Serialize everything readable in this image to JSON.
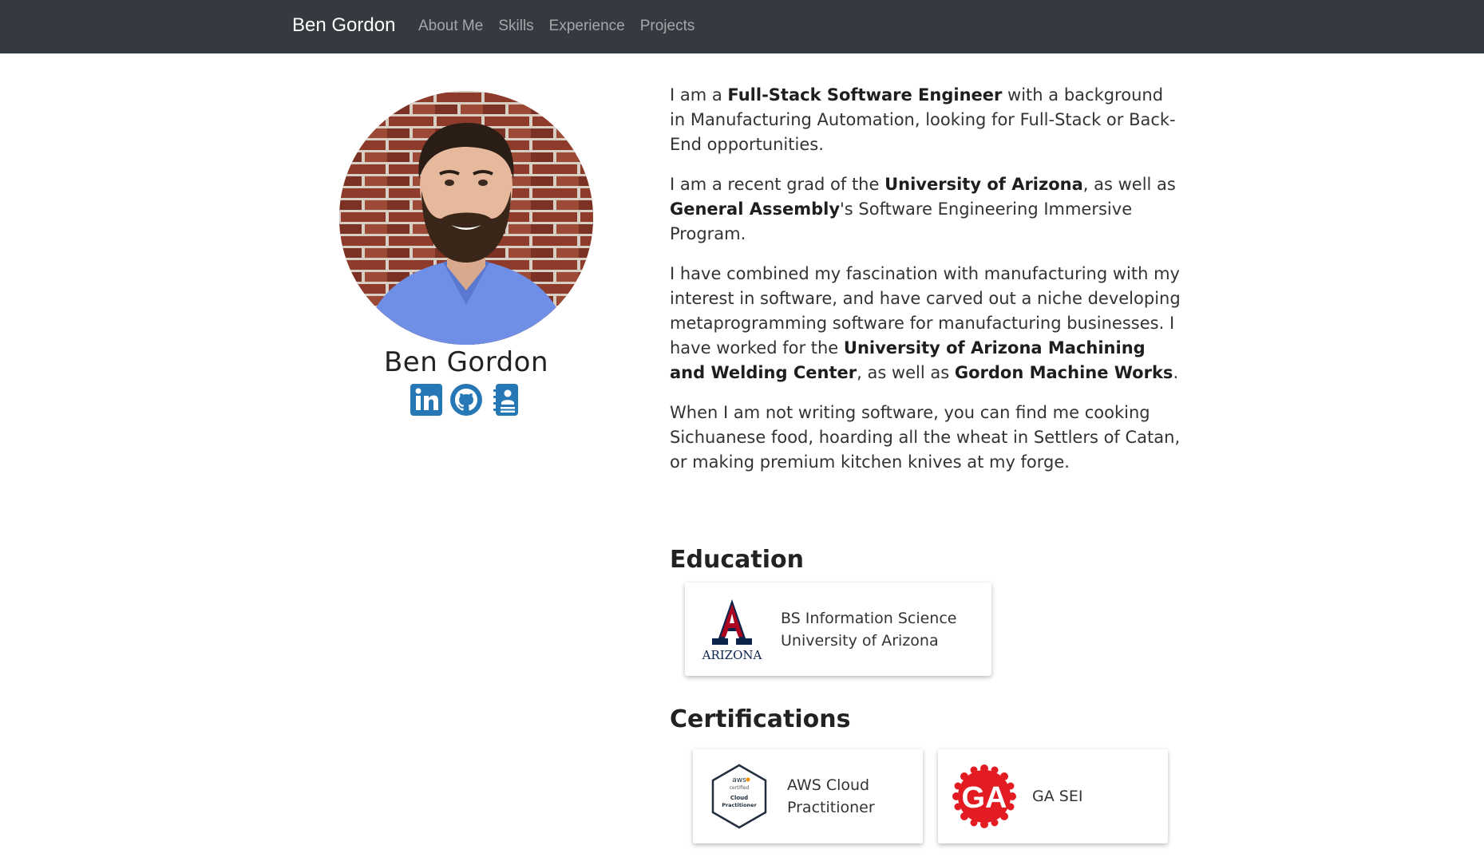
{
  "navbar": {
    "brand": "Ben Gordon",
    "links": [
      "About Me",
      "Skills",
      "Experience",
      "Projects"
    ]
  },
  "profile": {
    "name": "Ben Gordon",
    "social": [
      "linkedin-icon",
      "github-icon",
      "resume-icon"
    ]
  },
  "about": {
    "p1": {
      "t1": "I am a ",
      "b1": "Full-Stack Software Engineer",
      "t2": " with a background in Manufacturing Automation, looking for Full-Stack or Back-End opportunities."
    },
    "p2": {
      "t1": "I am a recent grad of the ",
      "b1": "University of Arizona",
      "t2": ", as well as ",
      "b2": "General Assembly",
      "t3": "'s Software Engineering Immersive Program."
    },
    "p3": {
      "t1": "I have combined my fascination with manufacturing with my interest in software, and have carved out a niche developing metaprogramming software for manufacturing businesses. I have worked for the ",
      "b1": "University of Arizona Machining and Welding Center",
      "t2": ", as well as ",
      "b2": "Gordon Machine Works",
      "t3": "."
    },
    "p4": "When I am not writing software, you can find me cooking Sichuanese food, hoarding all the wheat in Settlers of Catan, or making premium kitchen knives at my forge."
  },
  "education": {
    "title": "Education",
    "card": {
      "logo_text": "ARIZONA",
      "line1": "BS Information Science",
      "line2": "University of Arizona"
    }
  },
  "certifications": {
    "title": "Certifications",
    "items": [
      {
        "badge_lines": [
          "aws",
          "certified",
          "Cloud",
          "Practitioner"
        ],
        "line1": "AWS Cloud",
        "line2": "Practitioner"
      },
      {
        "badge_text": "GA",
        "line1": "GA SEI"
      }
    ]
  },
  "colors": {
    "navbar": "#343a40",
    "social_blue": "#2577b5",
    "arizona_red": "#ab0520",
    "arizona_navy": "#0c234b",
    "ga_red": "#e31b23"
  }
}
